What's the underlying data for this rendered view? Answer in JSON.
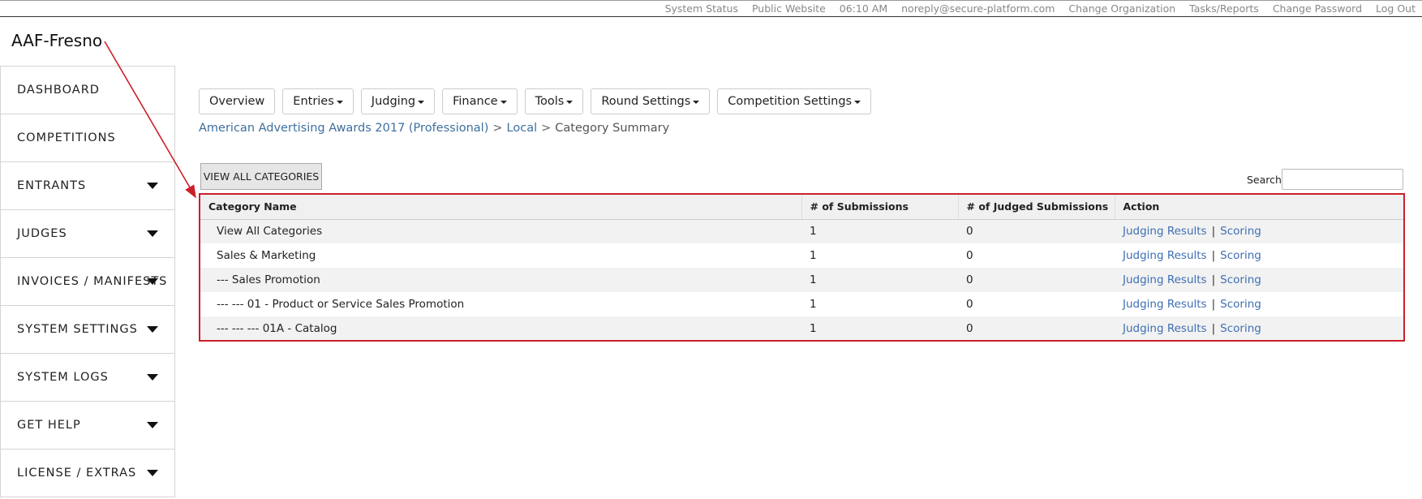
{
  "topbar": {
    "links": [
      "System Status",
      "Public Website",
      "06:10 AM",
      "noreply@secure-platform.com",
      "Change Organization",
      "Tasks/Reports",
      "Change Password",
      "Log Out"
    ]
  },
  "org": {
    "name": "AAF-Fresno"
  },
  "sidebar": {
    "items": [
      {
        "label": "DASHBOARD",
        "has_dropdown": false
      },
      {
        "label": "COMPETITIONS",
        "has_dropdown": false
      },
      {
        "label": "ENTRANTS",
        "has_dropdown": true
      },
      {
        "label": "JUDGES",
        "has_dropdown": true
      },
      {
        "label": "INVOICES / MANIFESTS",
        "has_dropdown": true
      },
      {
        "label": "SYSTEM SETTINGS",
        "has_dropdown": true
      },
      {
        "label": "SYSTEM LOGS",
        "has_dropdown": true
      },
      {
        "label": "GET HELP",
        "has_dropdown": true
      },
      {
        "label": "LICENSE / EXTRAS",
        "has_dropdown": true
      }
    ]
  },
  "nav": {
    "buttons": [
      {
        "label": "Overview",
        "dropdown": false
      },
      {
        "label": "Entries",
        "dropdown": true
      },
      {
        "label": "Judging",
        "dropdown": true
      },
      {
        "label": "Finance",
        "dropdown": true
      },
      {
        "label": "Tools",
        "dropdown": true
      },
      {
        "label": "Round Settings",
        "dropdown": true
      },
      {
        "label": "Competition Settings",
        "dropdown": true
      }
    ]
  },
  "breadcrumb": {
    "competition": "American Advertising Awards 2017 (Professional)",
    "round": "Local",
    "current": "Category Summary",
    "separator": ">"
  },
  "view_all_button": {
    "label": "VIEW ALL CATEGORIES"
  },
  "search": {
    "label": "Search:",
    "value": ""
  },
  "table": {
    "headers": [
      "Category Name",
      "# of Submissions",
      "# of Judged Submissions",
      "Action"
    ],
    "rows": [
      {
        "name": "View All Categories",
        "submissions": "1",
        "judged": "0"
      },
      {
        "name": "Sales & Marketing",
        "submissions": "1",
        "judged": "0"
      },
      {
        "name": "--- Sales Promotion",
        "submissions": "1",
        "judged": "0"
      },
      {
        "name": "--- --- 01 - Product or Service Sales Promotion",
        "submissions": "1",
        "judged": "0"
      },
      {
        "name": "--- --- --- 01A - Catalog",
        "submissions": "1",
        "judged": "0"
      }
    ],
    "action_links": {
      "results": "Judging Results",
      "separator": "|",
      "scoring": "Scoring"
    }
  },
  "colors": {
    "link": "#3e6fb4",
    "breadcrumb_link": "#3e6f9e",
    "annotation": "#cc1f2a"
  }
}
